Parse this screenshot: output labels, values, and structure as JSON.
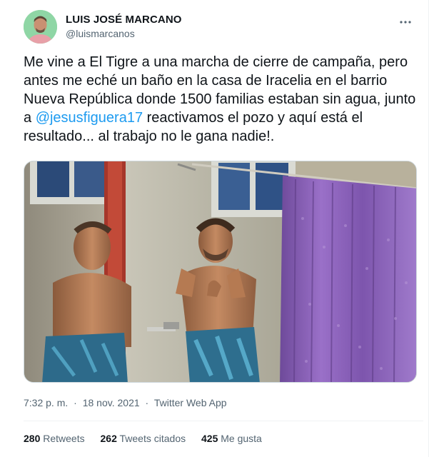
{
  "author": {
    "name": "LUIS JOSÉ MARCANO",
    "handle": "@luismarcanos"
  },
  "tweet": {
    "text_1": "Me vine a El Tigre a una marcha de cierre de campaña, pero antes me eché un baño en la casa de Iracelia en el barrio Nueva República donde 1500 familias estaban sin agua, junto a ",
    "mention": "@jesusfiguera17",
    "text_2": " reactivamos el pozo y aquí está el resultado... al trabajo no le gana nadie!."
  },
  "meta": {
    "time": "7:32 p. m.",
    "separator": "·",
    "date": "18 nov. 2021",
    "source": "Twitter Web App"
  },
  "stats": {
    "retweets_count": "280",
    "retweets_label": "Retweets",
    "quotes_count": "262",
    "quotes_label": "Tweets citados",
    "likes_count": "425",
    "likes_label": "Me gusta"
  },
  "icons": {
    "more": "more-horizontal-icon"
  },
  "colors": {
    "link": "#1d9bf0",
    "secondary_text": "#536471",
    "primary_text": "#0f1419",
    "curtain": "#8a5fb8"
  }
}
